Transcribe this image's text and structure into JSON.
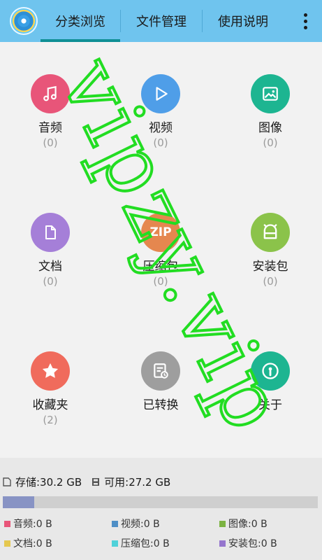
{
  "tabs": [
    {
      "label": "分类浏览"
    },
    {
      "label": "文件管理"
    },
    {
      "label": "使用说明"
    }
  ],
  "categories": [
    {
      "label": "音频",
      "count": "(0)",
      "color": "#e85579",
      "icon": "music-note-icon"
    },
    {
      "label": "视频",
      "count": "(0)",
      "color": "#4f9ee8",
      "icon": "play-icon"
    },
    {
      "label": "图像",
      "count": "(0)",
      "color": "#1db591",
      "icon": "image-icon"
    },
    {
      "label": "文档",
      "count": "(0)",
      "color": "#a57fd8",
      "icon": "document-icon"
    },
    {
      "label": "压缩包",
      "count": "(0)",
      "color": "#e5874f",
      "icon": "zip-icon",
      "icon_text": "ZIP"
    },
    {
      "label": "安装包",
      "count": "(0)",
      "color": "#8bc34a",
      "icon": "android-icon"
    },
    {
      "label": "收藏夹",
      "count": "(2)",
      "color": "#f06b5c",
      "icon": "star-icon"
    },
    {
      "label": "已转换",
      "count": "",
      "color": "#9e9e9e",
      "icon": "converted-doc-icon"
    },
    {
      "label": "关于",
      "count": "",
      "color": "#1db591",
      "icon": "info-icon"
    }
  ],
  "storage": {
    "total_label": "存储:30.2 GB",
    "free_label": "可用:27.2 GB",
    "used_fraction": 0.1
  },
  "legend": [
    {
      "text": "音频:0 B",
      "color": "#e85579"
    },
    {
      "text": "视频:0 B",
      "color": "#4f8fc6"
    },
    {
      "text": "图像:0 B",
      "color": "#7cb342"
    },
    {
      "text": "文档:0 B",
      "color": "#e5c84f"
    },
    {
      "text": "压缩包:0 B",
      "color": "#4fd1d9"
    },
    {
      "text": "安装包:0 B",
      "color": "#9575cd"
    }
  ],
  "watermark": {
    "text": "vipzy.vip",
    "color": "#22dd22"
  }
}
